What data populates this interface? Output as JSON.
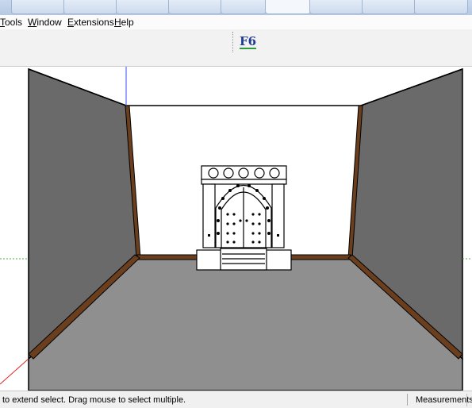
{
  "menu": {
    "tools": "Tools",
    "window": "Window",
    "extensions": "Extensions",
    "help": "Help"
  },
  "toolbar": {
    "plugin_button": "F6"
  },
  "status": {
    "hint": "to extend select. Drag mouse to select multiple.",
    "measurements_label": "Measurements"
  },
  "colors": {
    "wall": "#6a6a6a",
    "floor": "#8f8f8f",
    "trim": "#6b3f1d",
    "back_wall": "#ffffff"
  },
  "icons": [
    "plugin-f6-icon"
  ]
}
